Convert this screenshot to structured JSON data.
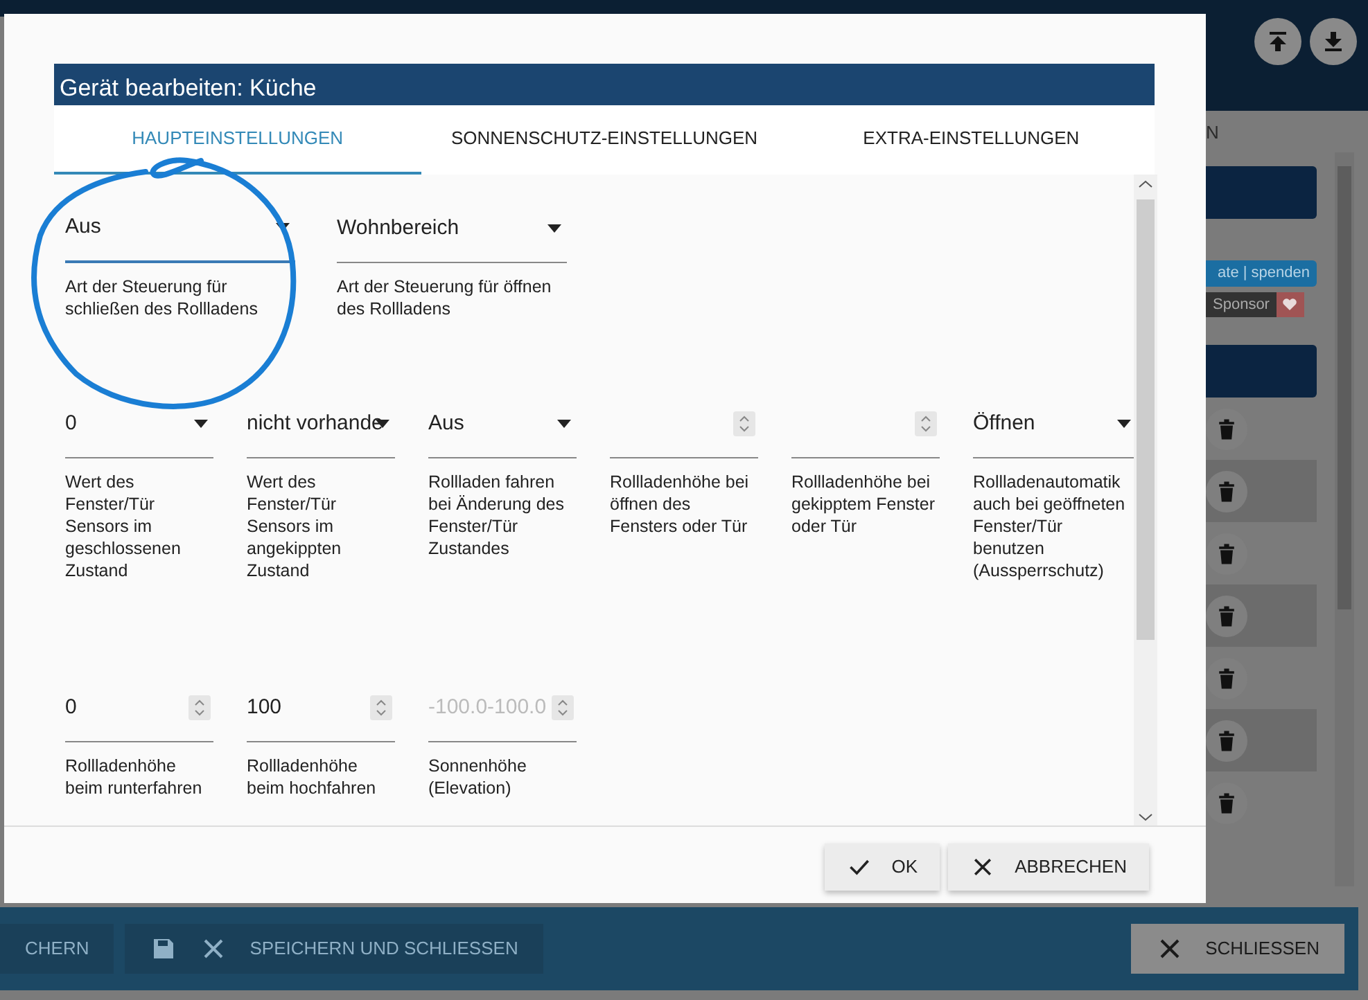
{
  "background": {
    "header_buttons": [
      {
        "kind": "upload"
      },
      {
        "kind": "download"
      }
    ],
    "tab_fragment": "N",
    "donate": "ate | spenden",
    "sponsor": "Sponsor",
    "footer_buttons": [
      {
        "label": "CHERN"
      },
      {
        "label": "SPEICHERN UND SCHLIESSEN"
      },
      {
        "label": "SCHLIESSEN"
      }
    ]
  },
  "dialog": {
    "title": "Gerät bearbeiten: Küche",
    "tabs": [
      {
        "label": "HAUPTEINSTELLUNGEN",
        "selected": true
      },
      {
        "label": "SONNENSCHUTZ-EINSTELLUNGEN",
        "selected": false
      },
      {
        "label": "EXTRA-EINSTELLUNGEN",
        "selected": false
      }
    ],
    "field_rows": [
      [
        {
          "kind": "select",
          "value": "Aus",
          "focused": true,
          "label": "Art der Steuerung für schließen des Rollladens"
        },
        {
          "kind": "select",
          "value": "Wohnbereich",
          "focused": false,
          "label": "Art der Steuerung für öffnen des Rollladens"
        }
      ],
      [
        {
          "kind": "select",
          "value": "0",
          "focused": false,
          "label": "Wert des Fenster/Tür Sensors im geschlossenen Zustand"
        },
        {
          "kind": "select",
          "value": "nicht vorhande",
          "focused": false,
          "label": "Wert des Fenster/Tür Sensors im angekippten Zustand"
        },
        {
          "kind": "select",
          "value": "Aus",
          "focused": false,
          "label": "Rollladen fahren bei Änderung des Fenster/Tür Zustandes"
        },
        {
          "kind": "number",
          "focused": false,
          "label": "Rollladenhöhe bei öffnen des Fensters oder Tür"
        },
        {
          "kind": "number",
          "focused": false,
          "label": "Rollladenhöhe bei gekipptem Fenster oder Tür"
        },
        {
          "kind": "select",
          "value": "Öffnen",
          "focused": false,
          "label": "Rollladenautomatik auch bei geöffneten Fenster/Tür benutzen (Aussperrschutz)"
        }
      ],
      [
        {
          "kind": "number",
          "value": "0",
          "focused": false,
          "label": "Rollladenhöhe beim runterfahren"
        },
        {
          "kind": "number",
          "value": "100",
          "focused": false,
          "label": "Rollladenhöhe beim hochfahren"
        },
        {
          "kind": "number",
          "placeholder": "-100.0-100.0",
          "focused": false,
          "label": "Sonnenhöhe (Elevation)"
        }
      ]
    ],
    "buttons": [
      {
        "label": "OK"
      },
      {
        "label": "ABBRECHEN"
      }
    ]
  },
  "annotation": {
    "kind": "circle"
  }
}
